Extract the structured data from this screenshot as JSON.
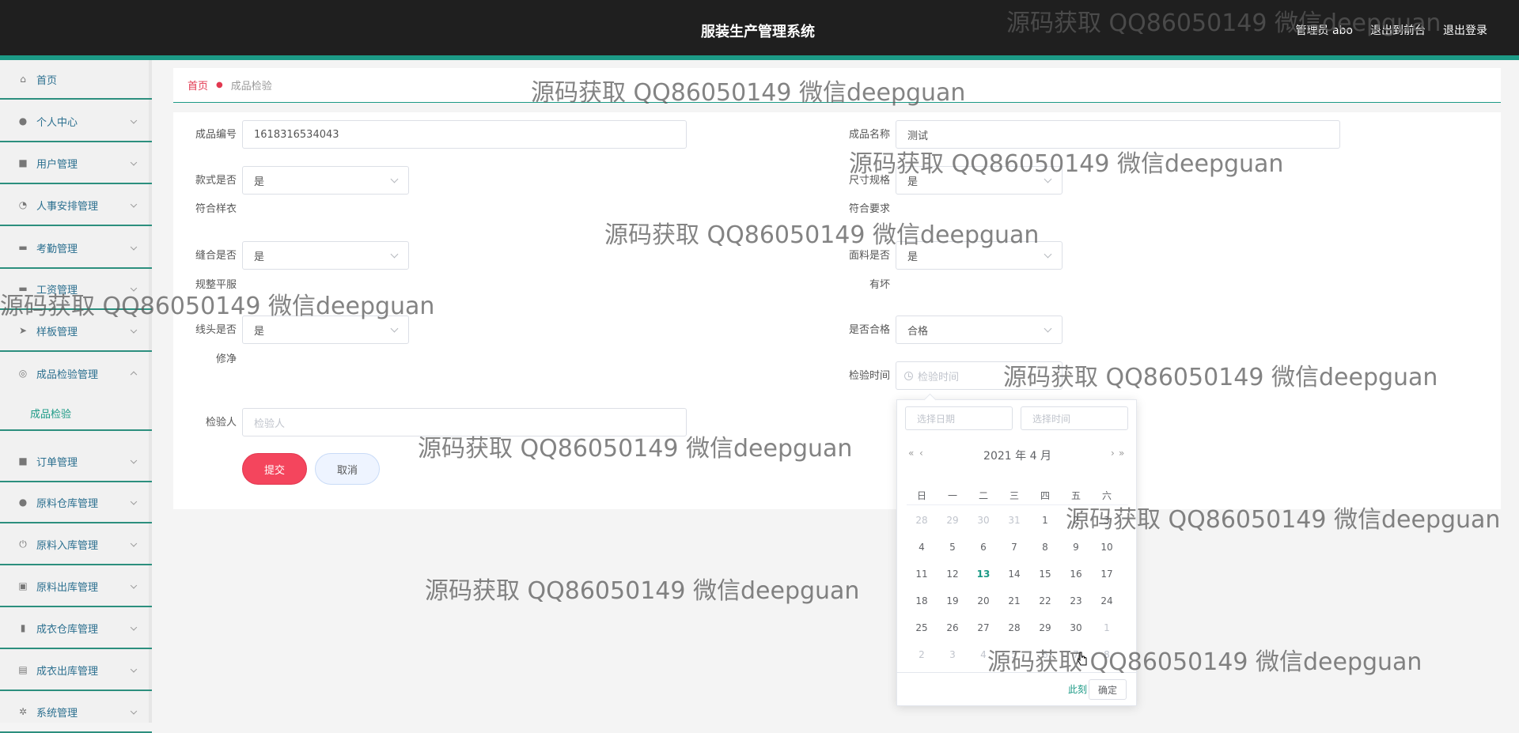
{
  "header": {
    "title": "服装生产管理系统",
    "nav": [
      "管理员 abo",
      "退出到前台",
      "退出登录"
    ]
  },
  "sidebar": {
    "items": [
      {
        "label": "首页",
        "icon": "home-icon",
        "glyph": "⌂"
      },
      {
        "label": "个人中心",
        "icon": "user-icon",
        "glyph": "●"
      },
      {
        "label": "用户管理",
        "icon": "list-icon",
        "glyph": "■"
      },
      {
        "label": "人事安排管理",
        "icon": "gauge-icon",
        "glyph": "◔"
      },
      {
        "label": "考勤管理",
        "icon": "chat-icon",
        "glyph": "▬"
      },
      {
        "label": "工资管理",
        "icon": "money-icon",
        "glyph": "▬"
      },
      {
        "label": "样板管理",
        "icon": "send-icon",
        "glyph": "➤"
      },
      {
        "label": "成品检验管理",
        "icon": "circle-icon",
        "glyph": "◎"
      },
      {
        "label": "订单管理",
        "icon": "cart-icon",
        "glyph": "■"
      },
      {
        "label": "原料仓库管理",
        "icon": "user-icon",
        "glyph": "●"
      },
      {
        "label": "原料入库管理",
        "icon": "power-icon",
        "glyph": "⏻"
      },
      {
        "label": "原料出库管理",
        "icon": "box-icon",
        "glyph": "▣"
      },
      {
        "label": "成衣仓库管理",
        "icon": "bar-chart-icon",
        "glyph": "▮"
      },
      {
        "label": "成衣出库管理",
        "icon": "clipboard-icon",
        "glyph": "▤"
      },
      {
        "label": "系统管理",
        "icon": "settings-icon",
        "glyph": "✲"
      }
    ],
    "submenu": {
      "label": "成品检验"
    }
  },
  "breadcrumb": {
    "home": "首页",
    "current": "成品检验"
  },
  "form": {
    "code_label": "成品编号",
    "code_value": "1618316534043",
    "name_label": "成品名称",
    "name_value": "测试",
    "style_label_1": "款式是否",
    "style_label_2": "符合样衣",
    "style_value": "是",
    "size_label_1": "尺寸规格",
    "size_label_2": "符合要求",
    "size_value": "是",
    "seam_label_1": "缝合是否",
    "seam_label_2": "规整平服",
    "seam_value": "是",
    "fabric_label_1": "面料是否",
    "fabric_label_2": "有坏",
    "fabric_value": "是",
    "thread_label_1": "线头是否",
    "thread_label_2": "修净",
    "thread_value": "是",
    "pass_label": "是否合格",
    "pass_value": "合格",
    "time_label": "检验时间",
    "time_placeholder": "检验时间",
    "inspector_label": "检验人",
    "inspector_placeholder": "检验人",
    "submit": "提交",
    "cancel": "取消"
  },
  "datepicker": {
    "date_placeholder": "选择日期",
    "time_placeholder": "选择时间",
    "year": "2021 年",
    "month": "4 月",
    "prev_year": "«",
    "prev_month": "‹",
    "next_month": "›",
    "next_year": "»",
    "weekdays": [
      "日",
      "一",
      "二",
      "三",
      "四",
      "五",
      "六"
    ],
    "weeks": [
      [
        "28",
        "29",
        "30",
        "31",
        "1",
        "2",
        "3"
      ],
      [
        "4",
        "5",
        "6",
        "7",
        "8",
        "9",
        "10"
      ],
      [
        "11",
        "12",
        "13",
        "14",
        "15",
        "16",
        "17"
      ],
      [
        "18",
        "19",
        "20",
        "21",
        "22",
        "23",
        "24"
      ],
      [
        "25",
        "26",
        "27",
        "28",
        "29",
        "30",
        "1"
      ],
      [
        "2",
        "3",
        "4",
        "5",
        "6",
        "7",
        "8"
      ]
    ],
    "today": "13",
    "now": "此刻",
    "ok": "确定"
  },
  "watermark": "源码获取 QQ86050149 微信deepguan"
}
